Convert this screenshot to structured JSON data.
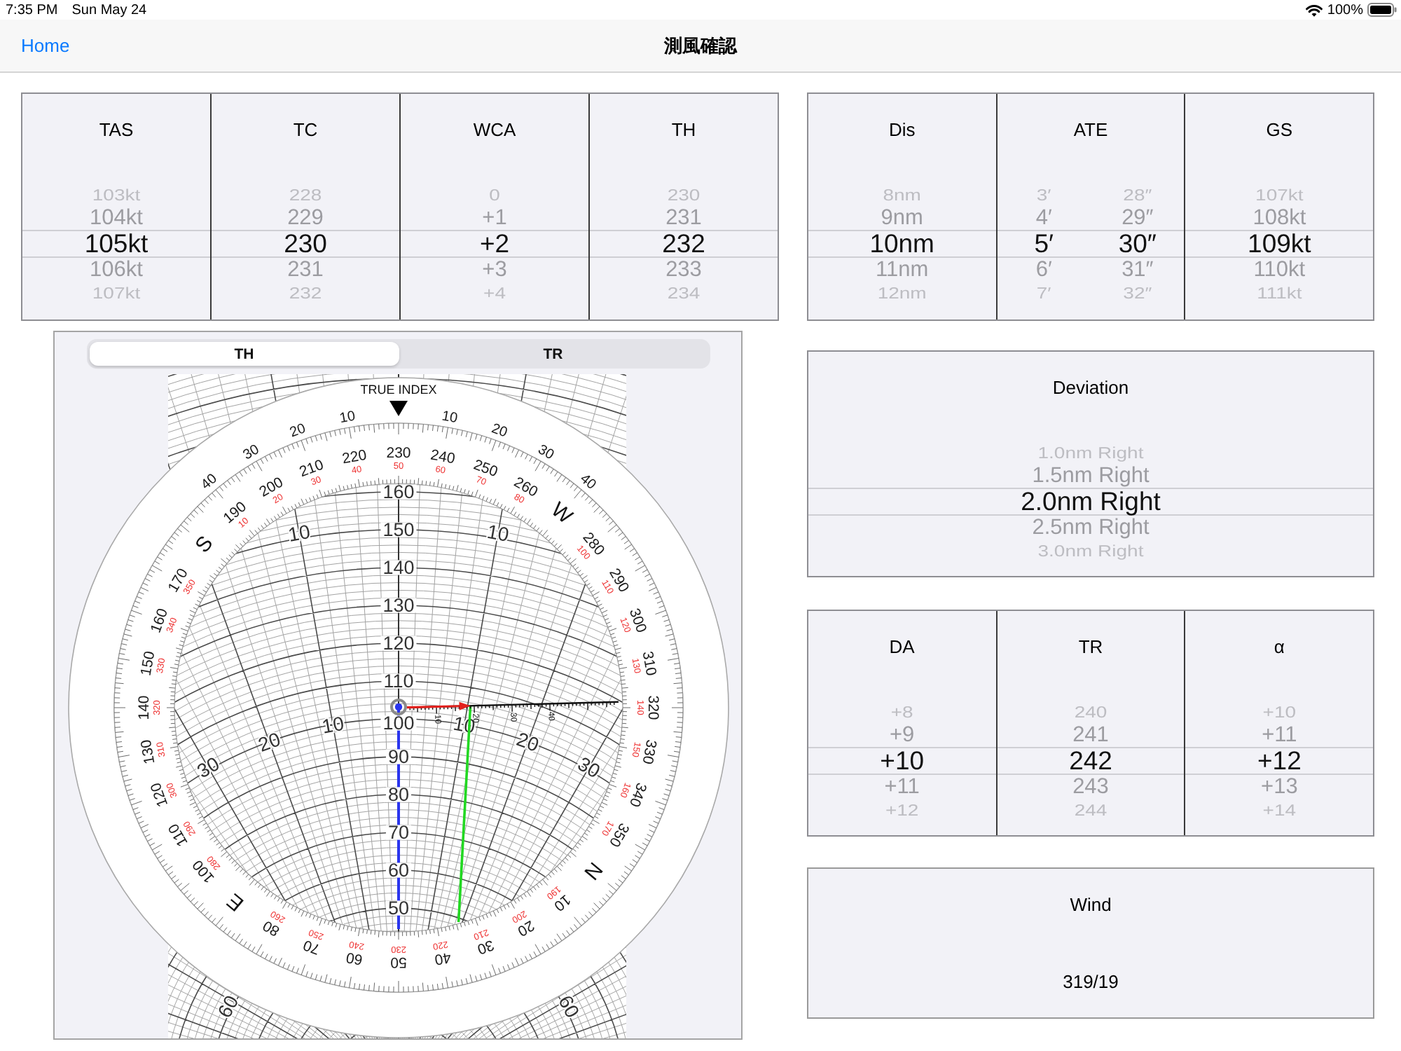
{
  "status_bar": {
    "time": "7:35 PM",
    "date": "Sun May 24",
    "battery": "100%"
  },
  "nav_bar": {
    "back": "Home",
    "title": "測風確認"
  },
  "course_picker": {
    "columns": [
      {
        "header": "TAS",
        "wheels": [
          {
            "items": [
              {
                "label": "103kt",
                "selected": false
              },
              {
                "label": "104kt",
                "selected": false
              },
              {
                "label": "105kt",
                "selected": true
              },
              {
                "label": "106kt",
                "selected": false
              },
              {
                "label": "107kt",
                "selected": false
              }
            ]
          }
        ]
      },
      {
        "header": "TC",
        "wheels": [
          {
            "items": [
              {
                "label": "228",
                "selected": false
              },
              {
                "label": "229",
                "selected": false
              },
              {
                "label": "230",
                "selected": true
              },
              {
                "label": "231",
                "selected": false
              },
              {
                "label": "232",
                "selected": false
              }
            ]
          }
        ]
      },
      {
        "header": "WCA",
        "wheels": [
          {
            "items": [
              {
                "label": "0",
                "selected": false
              },
              {
                "label": "+1",
                "selected": false
              },
              {
                "label": "+2",
                "selected": true
              },
              {
                "label": "+3",
                "selected": false
              },
              {
                "label": "+4",
                "selected": false
              }
            ]
          }
        ]
      },
      {
        "header": "TH",
        "wheels": [
          {
            "items": [
              {
                "label": "230",
                "selected": false
              },
              {
                "label": "231",
                "selected": false
              },
              {
                "label": "232",
                "selected": true
              },
              {
                "label": "233",
                "selected": false
              },
              {
                "label": "234",
                "selected": false
              }
            ]
          }
        ]
      }
    ]
  },
  "time_picker": {
    "columns": [
      {
        "header": "Dis",
        "wheels": [
          {
            "items": [
              {
                "label": "8nm",
                "selected": false
              },
              {
                "label": "9nm",
                "selected": false
              },
              {
                "label": "10nm",
                "selected": true
              },
              {
                "label": "11nm",
                "selected": false
              },
              {
                "label": "12nm",
                "selected": false
              }
            ]
          }
        ]
      },
      {
        "header": "ATE",
        "wheels": [
          {
            "items": [
              {
                "label": "3′",
                "selected": false
              },
              {
                "label": "4′",
                "selected": false
              },
              {
                "label": "5′",
                "selected": true
              },
              {
                "label": "6′",
                "selected": false
              },
              {
                "label": "7′",
                "selected": false
              }
            ]
          },
          {
            "items": [
              {
                "label": "28″",
                "selected": false
              },
              {
                "label": "29″",
                "selected": false
              },
              {
                "label": "30″",
                "selected": true
              },
              {
                "label": "31″",
                "selected": false
              },
              {
                "label": "32″",
                "selected": false
              }
            ]
          }
        ]
      },
      {
        "header": "GS",
        "wheels": [
          {
            "items": [
              {
                "label": "107kt",
                "selected": false
              },
              {
                "label": "108kt",
                "selected": false
              },
              {
                "label": "109kt",
                "selected": true
              },
              {
                "label": "110kt",
                "selected": false
              },
              {
                "label": "111kt",
                "selected": false
              }
            ]
          }
        ]
      }
    ]
  },
  "computer": {
    "tabs": [
      {
        "label": "TH",
        "selected": true
      },
      {
        "label": "TR",
        "selected": false
      }
    ],
    "index_label": "TRUE INDEX",
    "bezel_scale": [
      "40",
      "30",
      "20",
      "10",
      "10",
      "20",
      "30",
      "40"
    ],
    "dial": [
      {
        "kind": "cardinal",
        "label": "N"
      },
      {
        "kind": "degree",
        "label": "10",
        "inner_label": "190"
      },
      {
        "kind": "degree",
        "label": "20",
        "inner_label": "200"
      },
      {
        "kind": "degree",
        "label": "30",
        "inner_label": "210"
      },
      {
        "kind": "degree",
        "label": "40",
        "inner_label": "220"
      },
      {
        "kind": "degree",
        "label": "50",
        "inner_label": "230"
      },
      {
        "kind": "degree",
        "label": "60",
        "inner_label": "240"
      },
      {
        "kind": "degree",
        "label": "70",
        "inner_label": "250"
      },
      {
        "kind": "degree",
        "label": "80",
        "inner_label": "260"
      },
      {
        "kind": "cardinal",
        "label": "E"
      },
      {
        "kind": "degree",
        "label": "100",
        "inner_label": "280"
      },
      {
        "kind": "degree",
        "label": "110",
        "inner_label": "290"
      },
      {
        "kind": "degree",
        "label": "120",
        "inner_label": "300"
      },
      {
        "kind": "degree",
        "label": "130",
        "inner_label": "310"
      },
      {
        "kind": "degree",
        "label": "140",
        "inner_label": "320"
      },
      {
        "kind": "degree",
        "label": "150",
        "inner_label": "330"
      },
      {
        "kind": "degree",
        "label": "160",
        "inner_label": "340"
      },
      {
        "kind": "degree",
        "label": "170",
        "inner_label": "350"
      },
      {
        "kind": "cardinal",
        "label": "S"
      },
      {
        "kind": "degree",
        "label": "190",
        "inner_label": "10"
      },
      {
        "kind": "degree",
        "label": "200",
        "inner_label": "20"
      },
      {
        "kind": "degree",
        "label": "210",
        "inner_label": "30"
      },
      {
        "kind": "degree",
        "label": "220",
        "inner_label": "40"
      },
      {
        "kind": "degree",
        "label": "230",
        "inner_label": "50"
      },
      {
        "kind": "degree",
        "label": "240",
        "inner_label": "60"
      },
      {
        "kind": "degree",
        "label": "250",
        "inner_label": "70"
      },
      {
        "kind": "degree",
        "label": "260",
        "inner_label": "80"
      },
      {
        "kind": "cardinal",
        "label": "W"
      },
      {
        "kind": "degree",
        "label": "280",
        "inner_label": "100"
      },
      {
        "kind": "degree",
        "label": "290",
        "inner_label": "110"
      },
      {
        "kind": "degree",
        "label": "300",
        "inner_label": "120"
      },
      {
        "kind": "degree",
        "label": "310",
        "inner_label": "130"
      },
      {
        "kind": "degree",
        "label": "320",
        "inner_label": "140"
      },
      {
        "kind": "degree",
        "label": "330",
        "inner_label": "150"
      },
      {
        "kind": "degree",
        "label": "340",
        "inner_label": "160"
      },
      {
        "kind": "degree",
        "label": "350",
        "inner_label": "170"
      }
    ],
    "speed_labels": [
      "160",
      "150",
      "140",
      "130",
      "120",
      "110",
      "100",
      "90",
      "80",
      "70",
      "60",
      "50"
    ],
    "drift_labels": [
      "10",
      "10",
      "10",
      "10",
      "20",
      "20",
      "30",
      "30",
      "60",
      "60"
    ],
    "wind_scale_labels": [
      "10",
      "20",
      "30",
      "40"
    ]
  },
  "deviation_picker": {
    "columns": [
      {
        "header": "Deviation",
        "wheels": [
          {
            "items": [
              {
                "label": "1.0nm Right",
                "selected": false
              },
              {
                "label": "1.5nm Right",
                "selected": false
              },
              {
                "label": "2.0nm Right",
                "selected": true
              },
              {
                "label": "2.5nm Right",
                "selected": false
              },
              {
                "label": "3.0nm Right",
                "selected": false
              }
            ]
          }
        ]
      }
    ]
  },
  "correction_picker": {
    "columns": [
      {
        "header": "DA",
        "wheels": [
          {
            "items": [
              {
                "label": "+8",
                "selected": false
              },
              {
                "label": "+9",
                "selected": false
              },
              {
                "label": "+10",
                "selected": true
              },
              {
                "label": "+11",
                "selected": false
              },
              {
                "label": "+12",
                "selected": false
              }
            ]
          }
        ]
      },
      {
        "header": "TR",
        "wheels": [
          {
            "items": [
              {
                "label": "240",
                "selected": false
              },
              {
                "label": "241",
                "selected": false
              },
              {
                "label": "242",
                "selected": true
              },
              {
                "label": "243",
                "selected": false
              },
              {
                "label": "244",
                "selected": false
              }
            ]
          }
        ]
      },
      {
        "header": "α",
        "wheels": [
          {
            "items": [
              {
                "label": "+10",
                "selected": false
              },
              {
                "label": "+11",
                "selected": false
              },
              {
                "label": "+12",
                "selected": true
              },
              {
                "label": "+13",
                "selected": false
              },
              {
                "label": "+14",
                "selected": false
              }
            ]
          }
        ]
      }
    ]
  },
  "wind": {
    "label": "Wind",
    "value": "319/19"
  }
}
